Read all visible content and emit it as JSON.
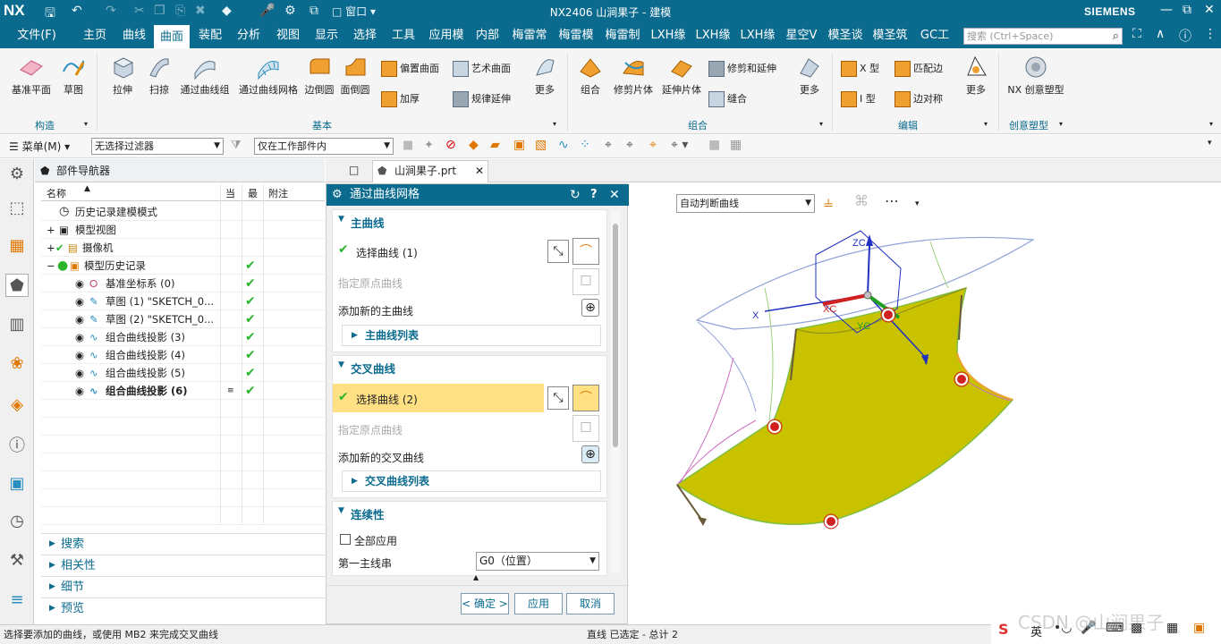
{
  "titlebar": {
    "logo": "NX",
    "window_menu": "窗口",
    "title": "NX2406 山涧果子 - 建模",
    "brand": "SIEMENS"
  },
  "menubar": {
    "tabs": [
      "文件(F)",
      "主页",
      "曲线",
      "曲面",
      "装配",
      "分析",
      "视图",
      "显示",
      "选择",
      "工具",
      "应用模",
      "内部",
      "梅雷常",
      "梅雷模",
      "梅雷制",
      "LXH缘",
      "LXH缘",
      "LXH缘",
      "星空V",
      "模圣谈",
      "模圣筑",
      "GC工"
    ],
    "active_tab": "曲面",
    "search_placeholder": "搜索 (Ctrl+Space)"
  },
  "ribbon": {
    "groups": {
      "construct": {
        "label": "构造",
        "buttons": [
          "基准平面",
          "草图"
        ]
      },
      "basic": {
        "label": "基本",
        "buttons": [
          "拉伸",
          "扫掠",
          "通过曲线组",
          "通过曲线网格",
          "边倒圆",
          "面倒圆"
        ],
        "small": [
          "偏置曲面",
          "加厚",
          "艺术曲面",
          "规律延伸"
        ],
        "more": "更多"
      },
      "combine": {
        "label": "组合",
        "buttons": [
          "组合",
          "修剪片体",
          "延伸片体"
        ],
        "small": [
          "修剪和延伸",
          "缝合"
        ],
        "more": "更多"
      },
      "edit": {
        "label": "编辑",
        "small": [
          "X 型",
          "I 型",
          "匹配边",
          "边对称"
        ],
        "more": "更多"
      },
      "creative": {
        "label": "创意塑型",
        "buttons": [
          "NX 创意塑型"
        ]
      }
    }
  },
  "filterbar": {
    "menu": "菜单(M)",
    "selection_filter": "无选择过滤器",
    "scope": "仅在工作部件内"
  },
  "navigator": {
    "title": "部件导航器",
    "columns": [
      "名称",
      "当",
      "最",
      "附注"
    ],
    "rows": [
      {
        "label": "历史记录建模模式",
        "done": false
      },
      {
        "label": "模型视图",
        "done": false
      },
      {
        "label": "摄像机",
        "done": false
      },
      {
        "label": "模型历史记录",
        "done": true
      },
      {
        "label": "基准坐标系 (0)",
        "done": true
      },
      {
        "label": "草图 (1) \"SKETCH_0...",
        "done": true
      },
      {
        "label": "草图 (2) \"SKETCH_0...",
        "done": true
      },
      {
        "label": "组合曲线投影 (3)",
        "done": true
      },
      {
        "label": "组合曲线投影 (4)",
        "done": true
      },
      {
        "label": "组合曲线投影 (5)",
        "done": true
      },
      {
        "label": "组合曲线投影 (6)",
        "done": true
      }
    ],
    "panels": [
      "搜索",
      "相关性",
      "细节",
      "预览"
    ]
  },
  "doc_tab": {
    "label": "山涧果子.prt"
  },
  "dialog": {
    "title": "通过曲线网格",
    "primary": {
      "header": "主曲线",
      "select": "选择曲线 (1)",
      "origin": "指定原点曲线",
      "add": "添加新的主曲线",
      "list": "主曲线列表"
    },
    "cross": {
      "header": "交叉曲线",
      "select": "选择曲线 (2)",
      "origin": "指定原点曲线",
      "add": "添加新的交叉曲线",
      "list": "交叉曲线列表"
    },
    "continuity": {
      "header": "连续性",
      "apply_all": "全部应用",
      "first_primary": "第一主线串",
      "first_primary_value": "G0（位置）"
    },
    "buttons": {
      "ok": "< 确定 >",
      "apply": "应用",
      "cancel": "取消"
    }
  },
  "viewport": {
    "curve_rule": "自动判断曲线",
    "axes": {
      "zc": "ZC",
      "xc": "XC",
      "yc": "YC",
      "x": "X",
      "y": "Y"
    }
  },
  "status": {
    "prompt": "选择要添加的曲线，或使用 MB2 来完成交叉曲线",
    "selection": "直线 已选定 - 总计 2",
    "watermark": "CSDN @山涧果子",
    "ime": "英"
  },
  "colors": {
    "nx_blue": "#0b6b8e",
    "surface": "#c8c200",
    "highlight": "#ffe083"
  }
}
